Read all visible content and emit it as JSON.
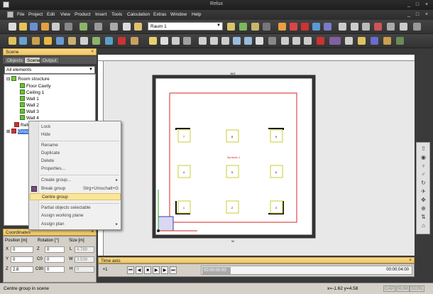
{
  "app": {
    "title": "Relux"
  },
  "menu": [
    "File",
    "Project",
    "Edit",
    "View",
    "Product",
    "Insert",
    "Tools",
    "Calculation",
    "Extras",
    "Window",
    "Help"
  ],
  "toolbar": {
    "room_value": "Raum 1"
  },
  "scene_panel": {
    "title": "Scene",
    "tabs": [
      "Objects",
      "Scene",
      "Output"
    ],
    "active_tab": "Scene",
    "filter": "All elements",
    "tree": [
      {
        "label": "Room structure",
        "level": 0
      },
      {
        "label": "Floor Cavity",
        "level": 1
      },
      {
        "label": "Ceiling 1",
        "level": 1
      },
      {
        "label": "Wall 1",
        "level": 1
      },
      {
        "label": "Wall 2",
        "level": 1
      },
      {
        "label": "Wall 3",
        "level": 1
      },
      {
        "label": "Wall 4",
        "level": 1
      },
      {
        "label": "Refe",
        "level": 0
      },
      {
        "label": "Grou",
        "level": 0,
        "selected": true
      }
    ]
  },
  "context_menu": {
    "items": [
      {
        "label": "Lock"
      },
      {
        "label": "Hide"
      },
      {
        "label": "Rename"
      },
      {
        "label": "Duplicate"
      },
      {
        "label": "Delete"
      },
      {
        "label": "Properties..."
      },
      {
        "label": "Create group...",
        "submenu": true
      },
      {
        "label": "Break group",
        "shortcut": "Strg+Umschalt+G"
      },
      {
        "label": "Centre group",
        "highlighted": true
      },
      {
        "label": "Partial objects selectable"
      },
      {
        "label": "Assign working plane"
      },
      {
        "label": "Assign plan",
        "submenu": true
      }
    ]
  },
  "coordinates": {
    "title": "Coordinates",
    "position_label": "Position [m]",
    "rotation_label": "Rotation [°]",
    "size_label": "Size [m]",
    "x_label": "X",
    "x_value": "0",
    "y_label": "Y",
    "y_value": "0",
    "z_label": "Z",
    "z_value": "2.8",
    "rz_label": "Z",
    "rz_value": "0",
    "c0_label": "C0",
    "c0_value": "0",
    "c90_label": "C90",
    "c90_value": "0",
    "l_label": "L",
    "l_value": "4.789",
    "w_label": "W",
    "w_value": "3.539",
    "h_label": "H",
    "h_value": "0"
  },
  "canvas": {
    "north_label": "W/2",
    "south_label": "W",
    "luminaire_labels": [
      "7",
      "8",
      "9",
      "4",
      "5",
      "6",
      "1",
      "2",
      "3"
    ],
    "group_label": "Symbols 1"
  },
  "time_axis": {
    "title": "Time axis",
    "start_time": "00:00:00:00",
    "end_time": "00:00:04:00"
  },
  "status": {
    "message": "Centre group in scene",
    "coords": "x=-1.62 y=4.58",
    "indicators": [
      "CAP",
      "NUM",
      "SCRL"
    ]
  }
}
